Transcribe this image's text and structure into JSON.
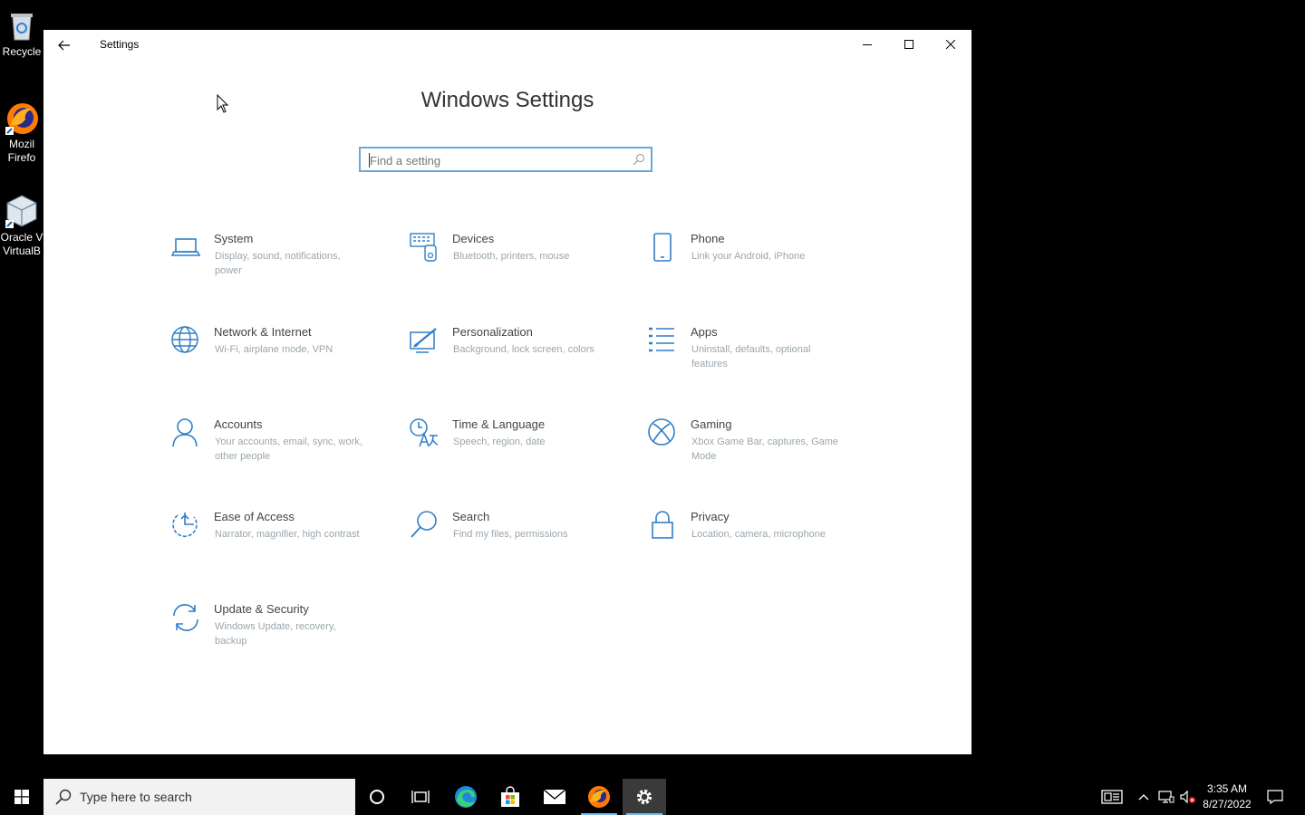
{
  "desktop": {
    "icons": [
      {
        "label": "Recycle",
        "icon": "recycle-bin-icon"
      },
      {
        "label": "Mozil\nFirefo",
        "line1": "Mozil",
        "line2": "Firefo",
        "icon": "firefox-icon"
      },
      {
        "label": "Oracle V\nVirtualB",
        "line1": "Oracle V",
        "line2": "VirtualB",
        "icon": "virtualbox-icon"
      }
    ]
  },
  "window": {
    "title": "Settings",
    "heading": "Windows Settings",
    "search_placeholder": "Find a setting",
    "tiles": [
      {
        "name": "System",
        "desc": "Display, sound, notifications, power",
        "icon": "laptop-icon"
      },
      {
        "name": "Devices",
        "desc": "Bluetooth, printers, mouse",
        "icon": "devices-icon"
      },
      {
        "name": "Phone",
        "desc": "Link your Android, iPhone",
        "icon": "phone-icon"
      },
      {
        "name": "Network & Internet",
        "desc": "Wi-Fi, airplane mode, VPN",
        "icon": "globe-icon"
      },
      {
        "name": "Personalization",
        "desc": "Background, lock screen, colors",
        "icon": "paint-icon"
      },
      {
        "name": "Apps",
        "desc": "Uninstall, defaults, optional features",
        "icon": "apps-list-icon"
      },
      {
        "name": "Accounts",
        "desc": "Your accounts, email, sync, work, other people",
        "icon": "person-icon"
      },
      {
        "name": "Time & Language",
        "desc": "Speech, region, date",
        "icon": "time-language-icon"
      },
      {
        "name": "Gaming",
        "desc": "Xbox Game Bar, captures, Game Mode",
        "icon": "xbox-icon"
      },
      {
        "name": "Ease of Access",
        "desc": "Narrator, magnifier, high contrast",
        "icon": "ease-of-access-icon"
      },
      {
        "name": "Search",
        "desc": "Find my files, permissions",
        "icon": "search-icon"
      },
      {
        "name": "Privacy",
        "desc": "Location, camera, microphone",
        "icon": "lock-icon"
      },
      {
        "name": "Update & Security",
        "desc": "Windows Update, recovery, backup",
        "icon": "sync-icon"
      }
    ]
  },
  "taskbar": {
    "search_placeholder": "Type here to search",
    "time": "3:35 AM",
    "date": "8/27/2022"
  },
  "colors": {
    "accent": "#1a73c7",
    "icon_blue": "#2f7fc8",
    "desc_gray": "#9aa6ad"
  }
}
